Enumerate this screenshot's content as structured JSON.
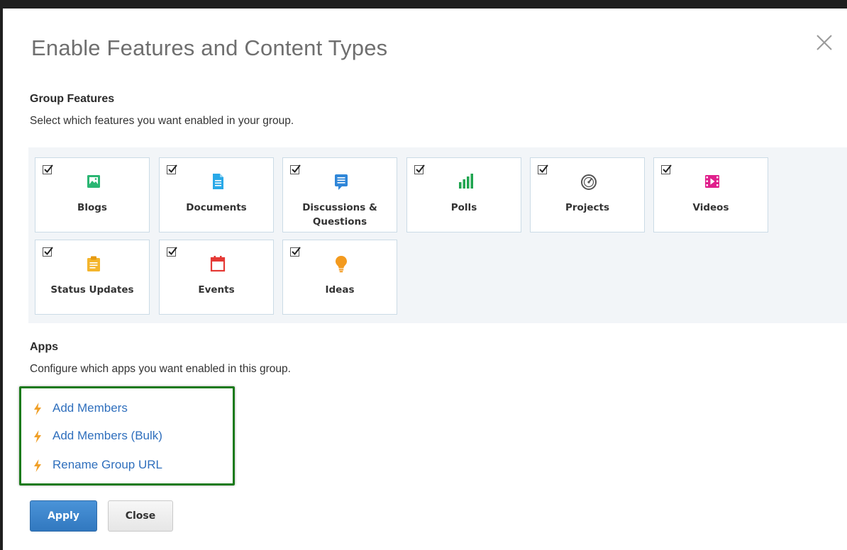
{
  "dialog": {
    "title": "Enable Features and Content Types",
    "close_icon": "close-icon"
  },
  "group_features": {
    "heading": "Group Features",
    "description": "Select which features you want enabled in your group.",
    "items": [
      {
        "label": "Blogs",
        "checked": true,
        "icon": "blog-icon",
        "color": "#2bb673"
      },
      {
        "label": "Documents",
        "checked": true,
        "icon": "document-icon",
        "color": "#29a9e8"
      },
      {
        "label": "Discussions & Questions",
        "checked": true,
        "icon": "discussion-icon",
        "color": "#2f86d8"
      },
      {
        "label": "Polls",
        "checked": true,
        "icon": "poll-icon",
        "color": "#20a550"
      },
      {
        "label": "Projects",
        "checked": true,
        "icon": "project-icon",
        "color": "#555555"
      },
      {
        "label": "Videos",
        "checked": true,
        "icon": "video-icon",
        "color": "#e0208c"
      },
      {
        "label": "Status Updates",
        "checked": true,
        "icon": "status-update-icon",
        "color": "#f4b52c"
      },
      {
        "label": "Events",
        "checked": true,
        "icon": "event-icon",
        "color": "#e53935"
      },
      {
        "label": "Ideas",
        "checked": true,
        "icon": "idea-icon",
        "color": "#f39a1e"
      }
    ]
  },
  "apps": {
    "heading": "Apps",
    "description": "Configure which apps you want enabled in this group.",
    "items": [
      {
        "label": "Add Members",
        "icon": "bolt-icon"
      },
      {
        "label": "Add Members (Bulk)",
        "icon": "bolt-icon"
      },
      {
        "label": "Rename Group URL",
        "icon": "bolt-icon"
      }
    ],
    "highlight_color": "#1a7a1a"
  },
  "buttons": {
    "apply": "Apply",
    "close": "Close"
  },
  "colors": {
    "link": "#2f6fbd",
    "primary_button": "#3a85cc",
    "panel_background": "#f2f5f8"
  }
}
